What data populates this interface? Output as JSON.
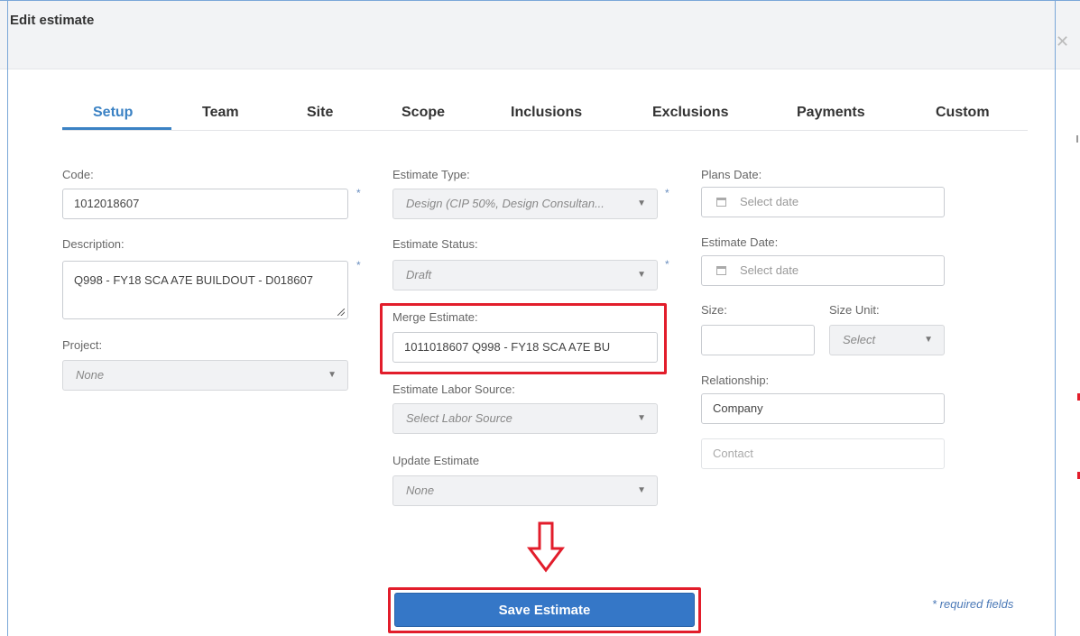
{
  "dialog": {
    "title": "Edit estimate",
    "close_glyph": "✕"
  },
  "tabs": [
    "Setup",
    "Team",
    "Site",
    "Scope",
    "Inclusions",
    "Exclusions",
    "Payments",
    "Custom"
  ],
  "active_tab": "Setup",
  "left": {
    "code_label": "Code:",
    "code_value": "1012018607",
    "description_label": "Description:",
    "description_value": "Q998 - FY18 SCA A7E BUILDOUT - D018607",
    "project_label": "Project:",
    "project_value": "None"
  },
  "middle": {
    "estimate_type_label": "Estimate Type:",
    "estimate_type_value": "Design (CIP 50%, Design Consultan...",
    "estimate_status_label": "Estimate Status:",
    "estimate_status_value": "Draft",
    "merge_label": "Merge Estimate:",
    "merge_value": "1011018607  Q998 - FY18 SCA A7E BU",
    "labor_source_label": "Estimate Labor Source:",
    "labor_source_value": "Select Labor Source",
    "update_label": "Update Estimate",
    "update_value": "None"
  },
  "right": {
    "plans_date_label": "Plans Date:",
    "plans_date_placeholder": "Select date",
    "estimate_date_label": "Estimate Date:",
    "estimate_date_placeholder": "Select date",
    "size_label": "Size:",
    "size_unit_label": "Size Unit:",
    "size_unit_value": "Select",
    "relationship_label": "Relationship:",
    "company_value": "Company",
    "contact_placeholder": "Contact"
  },
  "required_marker": "*",
  "save_label": "Save Estimate",
  "required_note": "* required fields",
  "icons": [
    "close-icon",
    "calendar-icon",
    "chevron-down-icon",
    "down-arrow-icon"
  ],
  "colors": {
    "accent": "#3b82c4",
    "button": "#3577c7",
    "highlight": "#e21d2b"
  }
}
